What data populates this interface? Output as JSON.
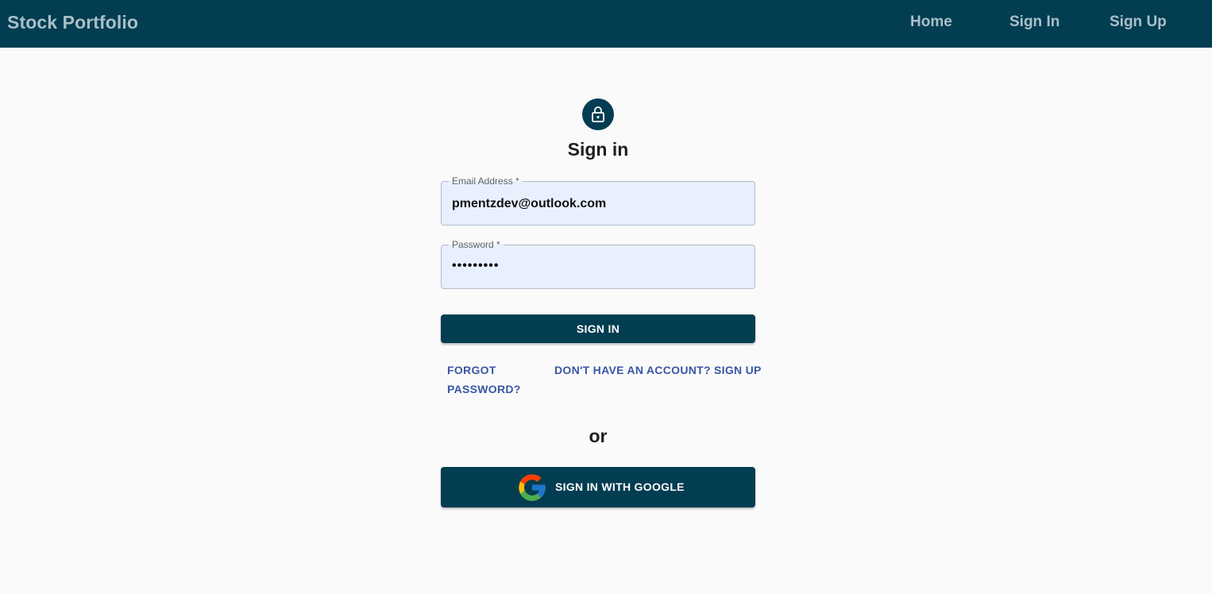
{
  "appbar": {
    "brand": "Stock Portfolio",
    "nav": {
      "home": "Home",
      "sign_in": "Sign In",
      "sign_up": "Sign Up"
    },
    "background_color": "#033d52"
  },
  "form": {
    "icon": "lock-icon",
    "title": "Sign in",
    "email": {
      "label": "Email Address *",
      "value": "pmentzdev@outlook.com"
    },
    "password": {
      "label": "Password *",
      "value": "•••••••••"
    },
    "submit_label": "SIGN IN",
    "forgot_password": "FORGOT PASSWORD?",
    "signup_link": "DON'T HAVE AN ACCOUNT? SIGN UP",
    "divider_text": "or",
    "google_button": {
      "icon": "google-icon",
      "label": "SIGN IN WITH GOOGLE"
    }
  }
}
